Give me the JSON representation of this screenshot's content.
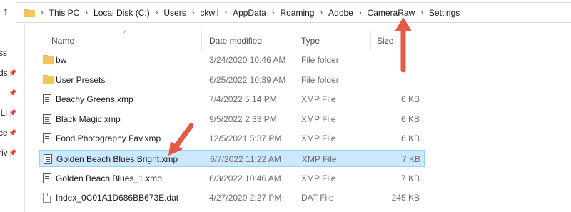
{
  "window": {
    "title": "Settings"
  },
  "address": {
    "up_glyph": "↑",
    "separator": "›",
    "crumbs": [
      "This PC",
      "Local Disk (C:)",
      "Users",
      "ckwil",
      "AppData",
      "Roaming",
      "Adobe",
      "CameraRaw",
      "Settings"
    ]
  },
  "nav": {
    "items": [
      {
        "label": "ss",
        "pinned": false
      },
      {
        "label": "ds",
        "pinned": true
      },
      {
        "label": "",
        "pinned": true
      },
      {
        "label": "Li",
        "pinned": true
      },
      {
        "label": "ce",
        "pinned": true
      },
      {
        "label": "riv",
        "pinned": true
      }
    ],
    "pin_glyph": "📌"
  },
  "columns": {
    "name": "Name",
    "date": "Date modified",
    "type": "Type",
    "size": "Size",
    "sort_glyph": "^"
  },
  "files": [
    {
      "name": "bw",
      "date": "3/24/2020 10:46 AM",
      "type": "File folder",
      "size": "",
      "icon": "folder-icon",
      "selected": false
    },
    {
      "name": "User Presets",
      "date": "6/25/2022 10:39 AM",
      "type": "File folder",
      "size": "",
      "icon": "folder-icon",
      "selected": false
    },
    {
      "name": "Beachy Greens.xmp",
      "date": "7/4/2022 5:14 PM",
      "type": "XMP File",
      "size": "6 KB",
      "icon": "xmp-file-icon",
      "selected": false
    },
    {
      "name": "Black Magic.xmp",
      "date": "9/5/2022 2:33 PM",
      "type": "XMP File",
      "size": "6 KB",
      "icon": "xmp-file-icon",
      "selected": false
    },
    {
      "name": "Food Photography Fav.xmp",
      "date": "12/5/2021 5:37 PM",
      "type": "XMP File",
      "size": "6 KB",
      "icon": "xmp-file-icon",
      "selected": false
    },
    {
      "name": "Golden Beach Blues Bright.xmp",
      "date": "6/7/2022 11:22 AM",
      "type": "XMP File",
      "size": "7 KB",
      "icon": "xmp-file-icon",
      "selected": true
    },
    {
      "name": "Golden Beach Blues_1.xmp",
      "date": "6/3/2022 10:46 AM",
      "type": "XMP File",
      "size": "7 KB",
      "icon": "xmp-file-icon",
      "selected": false
    },
    {
      "name": "Index_0C01A1D686BB673E.dat",
      "date": "4/27/2020 2:27 PM",
      "type": "DAT File",
      "size": "245 KB",
      "icon": "dat-file-icon",
      "selected": false
    }
  ],
  "colors": {
    "annotation_arrow": "#e05a47",
    "selection_fill": "#cce8ff",
    "selection_border": "#99d1ff",
    "folder": "#f2c55c"
  }
}
